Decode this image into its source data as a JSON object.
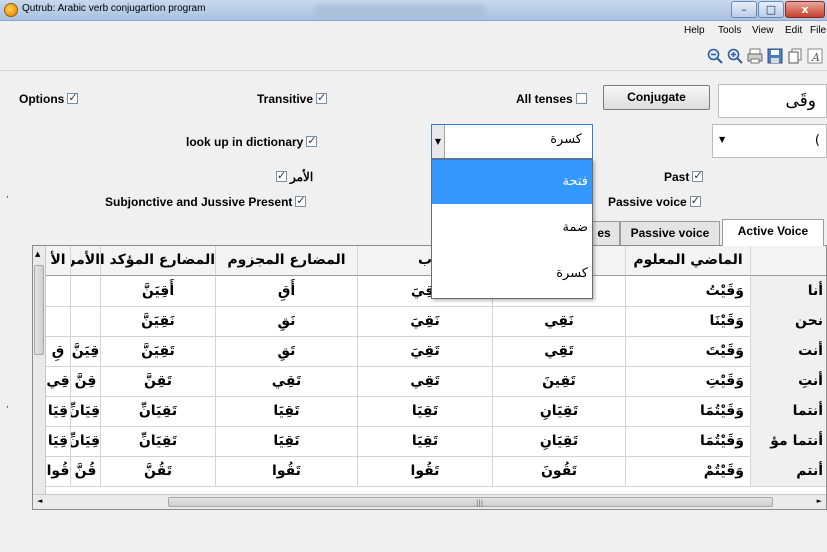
{
  "window": {
    "title": "Qutrub: Arabic verb conjugartion program",
    "min_glyph": "–",
    "max_glyph": "□",
    "close_glyph": "x"
  },
  "menu": [
    "Help",
    "Tools",
    "View",
    "Edit",
    "File"
  ],
  "toolbar_icons": [
    "zoom-out-icon",
    "zoom-in-icon",
    "print-icon",
    "save-icon",
    "copy-icon",
    "font-icon"
  ],
  "options": {
    "options_label": "Options",
    "transitive_label": "Transitive",
    "all_tenses_label": "All tenses",
    "conjugate_label": "Conjugate",
    "verb_value": "وقَى",
    "dictionary_label": "look up in dictionary",
    "haraka_value": "كسرة",
    "second_value": "(",
    "imperative_label": "الأمر",
    "past_label": "Past",
    "subjunctive_label": "Subjonctive and Jussive Present",
    "passive_label": "Passive voice",
    "checked": {
      "options": true,
      "transitive": true,
      "all_tenses": false,
      "dictionary": true,
      "imperative": true,
      "past": true,
      "subjunctive": true,
      "passive": true
    }
  },
  "haraka_dropdown": {
    "options": [
      "فتحة",
      "ضمة",
      "كسرة"
    ],
    "selected": 0
  },
  "tabs": {
    "partial": "es",
    "passive": "Passive voice",
    "active": "Active Voice"
  },
  "grid": {
    "headers": [
      "الماضي المعلوم",
      "المضارع",
      "ب",
      "المضارع المجزوم",
      "المضارع المؤكد الثقيل",
      "الأمر المؤكد",
      "الأ"
    ],
    "rows": [
      {
        "pronoun": "أنا",
        "cells": [
          "وَقَيْتُ",
          "أَقِي",
          "أَقِيَ",
          "أَقِ",
          "أَقِيَنَّ",
          "",
          ""
        ]
      },
      {
        "pronoun": "نحن",
        "cells": [
          "وَقَيْنَا",
          "نَقِي",
          "نَقِيَ",
          "نَقِ",
          "نَقِيَنَّ",
          "",
          ""
        ]
      },
      {
        "pronoun": "أنت",
        "cells": [
          "وَقَيْتَ",
          "تَقِي",
          "تَقِيَ",
          "تَقِ",
          "تَقِيَنَّ",
          "قِيَنَّ",
          "قِ"
        ]
      },
      {
        "pronoun": "أنتِ",
        "cells": [
          "وَقَيْتِ",
          "تَقِينَ",
          "تَقِي",
          "تَقِي",
          "تَقِنَّ",
          "قِنَّ",
          "قِي"
        ]
      },
      {
        "pronoun": "أنتما",
        "cells": [
          "وَقَيْتُمَا",
          "تَقِيَانِ",
          "تَقِيَا",
          "تَقِيَا",
          "تَقِيَانِّ",
          "قِيَانِّ",
          "قِيَا"
        ]
      },
      {
        "pronoun": "أنتما مؤ",
        "cells": [
          "وَقَيْتُمَا",
          "تَقِيَانِ",
          "تَقِيَا",
          "تَقِيَا",
          "تَقِيَانِّ",
          "قِيَانِّ",
          "قِيَا"
        ]
      },
      {
        "pronoun": "أنتم",
        "cells": [
          "وَقَيْتُمْ",
          "تَقُونَ",
          "تَقُوا",
          "تَقُوا",
          "تَقُنَّ",
          "قُنَّ",
          "قُوا"
        ]
      }
    ]
  }
}
